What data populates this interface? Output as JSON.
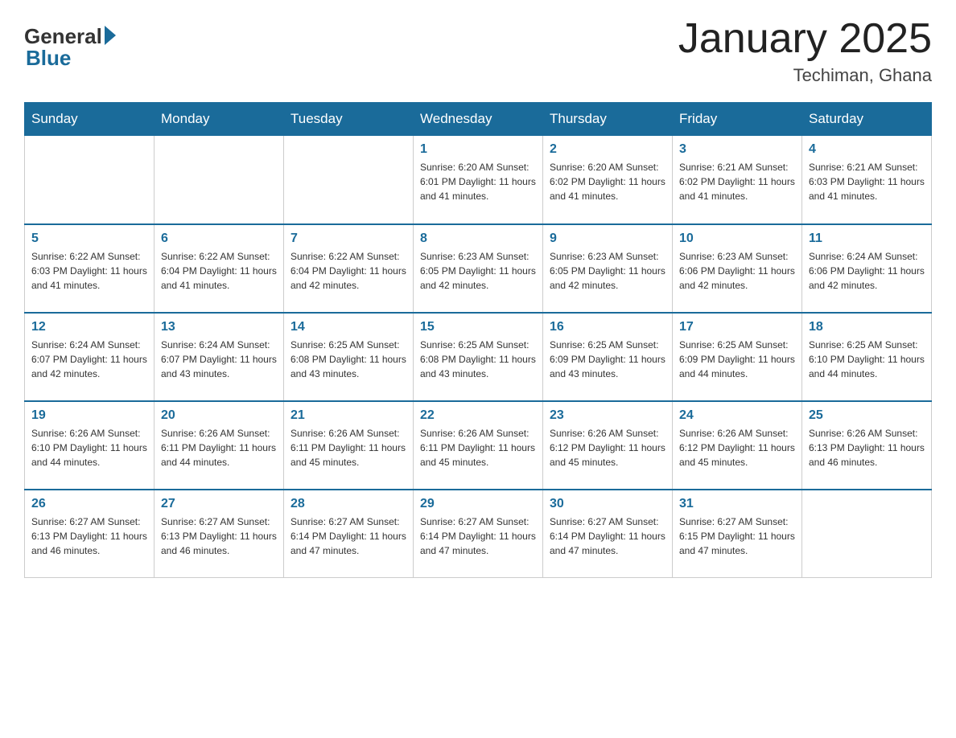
{
  "header": {
    "logo_general": "General",
    "logo_blue": "Blue",
    "month_title": "January 2025",
    "location": "Techiman, Ghana"
  },
  "days_of_week": [
    "Sunday",
    "Monday",
    "Tuesday",
    "Wednesday",
    "Thursday",
    "Friday",
    "Saturday"
  ],
  "weeks": [
    [
      {
        "day": "",
        "info": ""
      },
      {
        "day": "",
        "info": ""
      },
      {
        "day": "",
        "info": ""
      },
      {
        "day": "1",
        "info": "Sunrise: 6:20 AM\nSunset: 6:01 PM\nDaylight: 11 hours and 41 minutes."
      },
      {
        "day": "2",
        "info": "Sunrise: 6:20 AM\nSunset: 6:02 PM\nDaylight: 11 hours and 41 minutes."
      },
      {
        "day": "3",
        "info": "Sunrise: 6:21 AM\nSunset: 6:02 PM\nDaylight: 11 hours and 41 minutes."
      },
      {
        "day": "4",
        "info": "Sunrise: 6:21 AM\nSunset: 6:03 PM\nDaylight: 11 hours and 41 minutes."
      }
    ],
    [
      {
        "day": "5",
        "info": "Sunrise: 6:22 AM\nSunset: 6:03 PM\nDaylight: 11 hours and 41 minutes."
      },
      {
        "day": "6",
        "info": "Sunrise: 6:22 AM\nSunset: 6:04 PM\nDaylight: 11 hours and 41 minutes."
      },
      {
        "day": "7",
        "info": "Sunrise: 6:22 AM\nSunset: 6:04 PM\nDaylight: 11 hours and 42 minutes."
      },
      {
        "day": "8",
        "info": "Sunrise: 6:23 AM\nSunset: 6:05 PM\nDaylight: 11 hours and 42 minutes."
      },
      {
        "day": "9",
        "info": "Sunrise: 6:23 AM\nSunset: 6:05 PM\nDaylight: 11 hours and 42 minutes."
      },
      {
        "day": "10",
        "info": "Sunrise: 6:23 AM\nSunset: 6:06 PM\nDaylight: 11 hours and 42 minutes."
      },
      {
        "day": "11",
        "info": "Sunrise: 6:24 AM\nSunset: 6:06 PM\nDaylight: 11 hours and 42 minutes."
      }
    ],
    [
      {
        "day": "12",
        "info": "Sunrise: 6:24 AM\nSunset: 6:07 PM\nDaylight: 11 hours and 42 minutes."
      },
      {
        "day": "13",
        "info": "Sunrise: 6:24 AM\nSunset: 6:07 PM\nDaylight: 11 hours and 43 minutes."
      },
      {
        "day": "14",
        "info": "Sunrise: 6:25 AM\nSunset: 6:08 PM\nDaylight: 11 hours and 43 minutes."
      },
      {
        "day": "15",
        "info": "Sunrise: 6:25 AM\nSunset: 6:08 PM\nDaylight: 11 hours and 43 minutes."
      },
      {
        "day": "16",
        "info": "Sunrise: 6:25 AM\nSunset: 6:09 PM\nDaylight: 11 hours and 43 minutes."
      },
      {
        "day": "17",
        "info": "Sunrise: 6:25 AM\nSunset: 6:09 PM\nDaylight: 11 hours and 44 minutes."
      },
      {
        "day": "18",
        "info": "Sunrise: 6:25 AM\nSunset: 6:10 PM\nDaylight: 11 hours and 44 minutes."
      }
    ],
    [
      {
        "day": "19",
        "info": "Sunrise: 6:26 AM\nSunset: 6:10 PM\nDaylight: 11 hours and 44 minutes."
      },
      {
        "day": "20",
        "info": "Sunrise: 6:26 AM\nSunset: 6:11 PM\nDaylight: 11 hours and 44 minutes."
      },
      {
        "day": "21",
        "info": "Sunrise: 6:26 AM\nSunset: 6:11 PM\nDaylight: 11 hours and 45 minutes."
      },
      {
        "day": "22",
        "info": "Sunrise: 6:26 AM\nSunset: 6:11 PM\nDaylight: 11 hours and 45 minutes."
      },
      {
        "day": "23",
        "info": "Sunrise: 6:26 AM\nSunset: 6:12 PM\nDaylight: 11 hours and 45 minutes."
      },
      {
        "day": "24",
        "info": "Sunrise: 6:26 AM\nSunset: 6:12 PM\nDaylight: 11 hours and 45 minutes."
      },
      {
        "day": "25",
        "info": "Sunrise: 6:26 AM\nSunset: 6:13 PM\nDaylight: 11 hours and 46 minutes."
      }
    ],
    [
      {
        "day": "26",
        "info": "Sunrise: 6:27 AM\nSunset: 6:13 PM\nDaylight: 11 hours and 46 minutes."
      },
      {
        "day": "27",
        "info": "Sunrise: 6:27 AM\nSunset: 6:13 PM\nDaylight: 11 hours and 46 minutes."
      },
      {
        "day": "28",
        "info": "Sunrise: 6:27 AM\nSunset: 6:14 PM\nDaylight: 11 hours and 47 minutes."
      },
      {
        "day": "29",
        "info": "Sunrise: 6:27 AM\nSunset: 6:14 PM\nDaylight: 11 hours and 47 minutes."
      },
      {
        "day": "30",
        "info": "Sunrise: 6:27 AM\nSunset: 6:14 PM\nDaylight: 11 hours and 47 minutes."
      },
      {
        "day": "31",
        "info": "Sunrise: 6:27 AM\nSunset: 6:15 PM\nDaylight: 11 hours and 47 minutes."
      },
      {
        "day": "",
        "info": ""
      }
    ]
  ]
}
